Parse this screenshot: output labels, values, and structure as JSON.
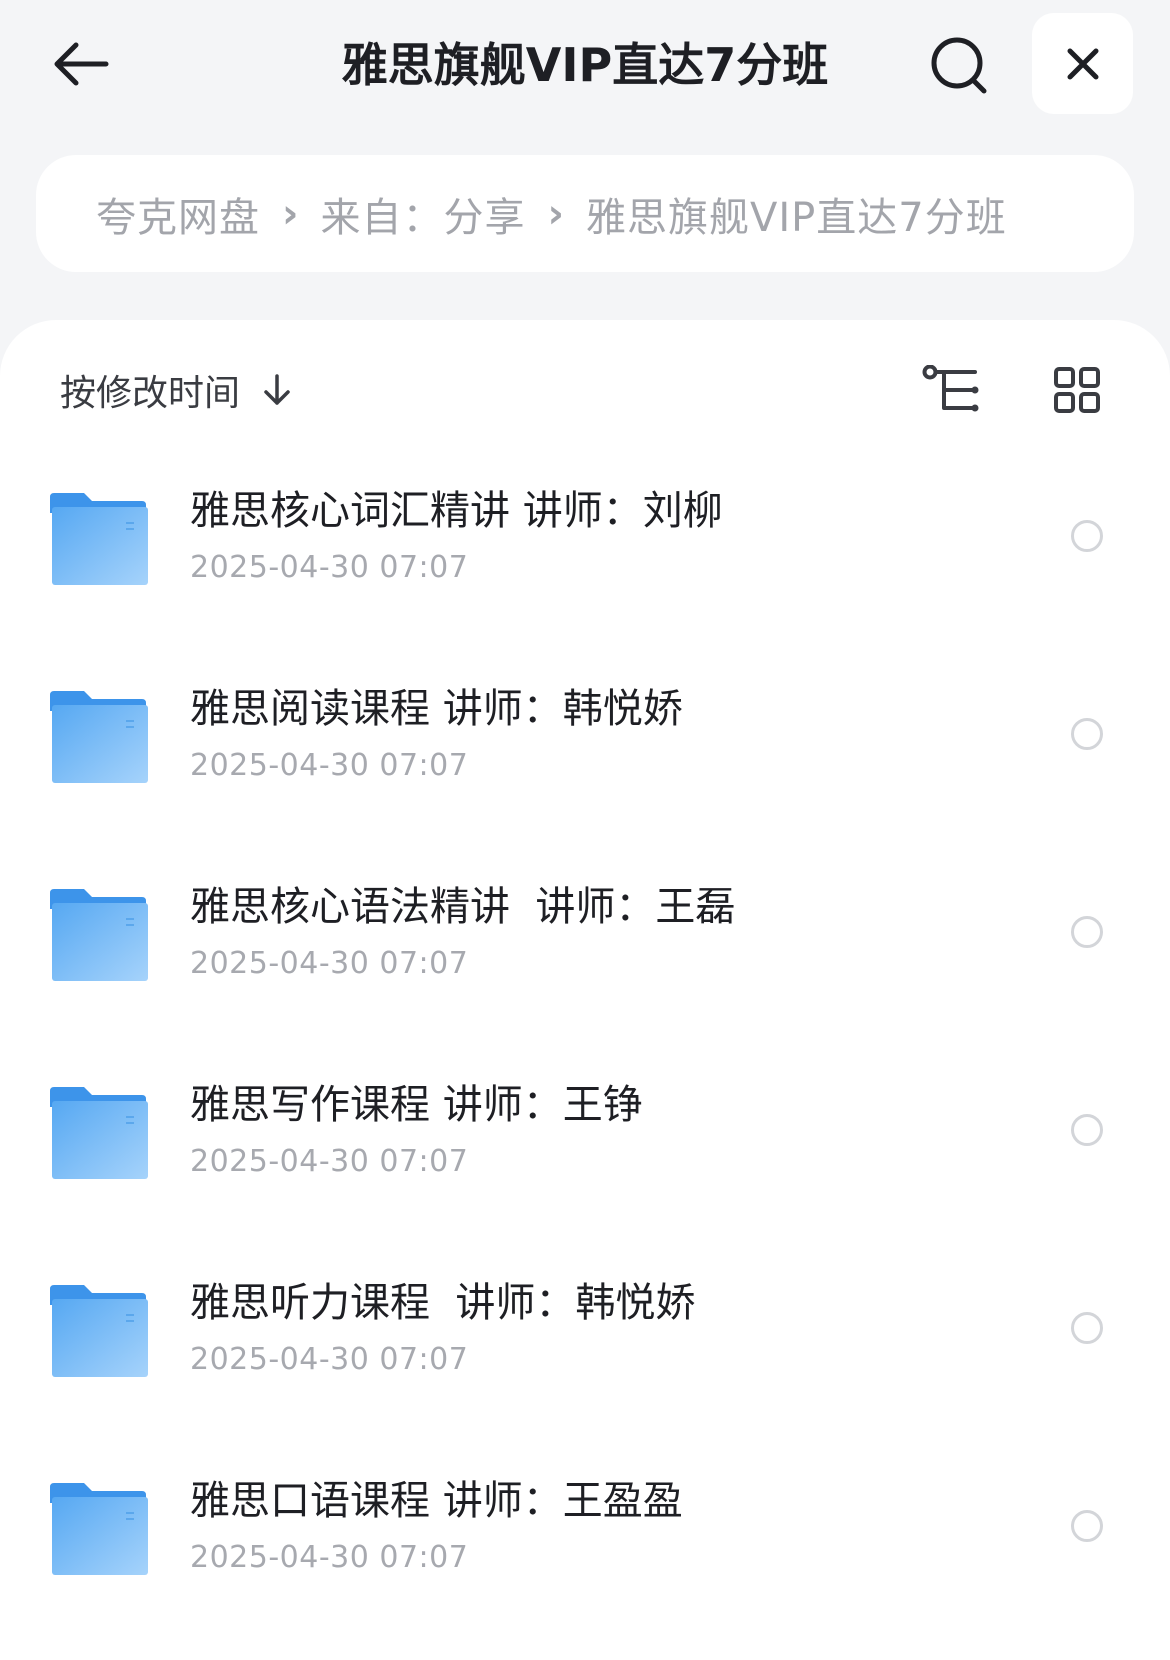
{
  "header": {
    "title": "雅思旗舰VIP直达7分班",
    "back_icon": "arrow-left-icon",
    "search_icon": "search-icon",
    "close_icon": "close-icon"
  },
  "breadcrumb": {
    "items": [
      "夸克网盘",
      "来自：分享",
      "雅思旗舰VIP直达7分班"
    ],
    "separator": "›"
  },
  "toolbar": {
    "sort_label": "按修改时间",
    "sort_icon": "arrow-down-icon",
    "tree_icon": "tree-view-icon",
    "grid_icon": "grid-view-icon"
  },
  "files": [
    {
      "name": "雅思核心词汇精讲 讲师：刘柳",
      "date": "2025-04-30 07:07",
      "type": "folder"
    },
    {
      "name": "雅思阅读课程 讲师：韩悦娇",
      "date": "2025-04-30 07:07",
      "type": "folder"
    },
    {
      "name": "雅思核心语法精讲  讲师：王磊",
      "date": "2025-04-30 07:07",
      "type": "folder"
    },
    {
      "name": "雅思写作课程 讲师：王铮",
      "date": "2025-04-30 07:07",
      "type": "folder"
    },
    {
      "name": "雅思听力课程  讲师：韩悦娇",
      "date": "2025-04-30 07:07",
      "type": "folder"
    },
    {
      "name": "雅思口语课程 讲师：王盈盈",
      "date": "2025-04-30 07:07",
      "type": "folder"
    }
  ],
  "colors": {
    "background": "#f4f5f7",
    "folder": "#5aaef5",
    "text_primary": "#1e1f24",
    "text_secondary": "#a7a9af"
  }
}
